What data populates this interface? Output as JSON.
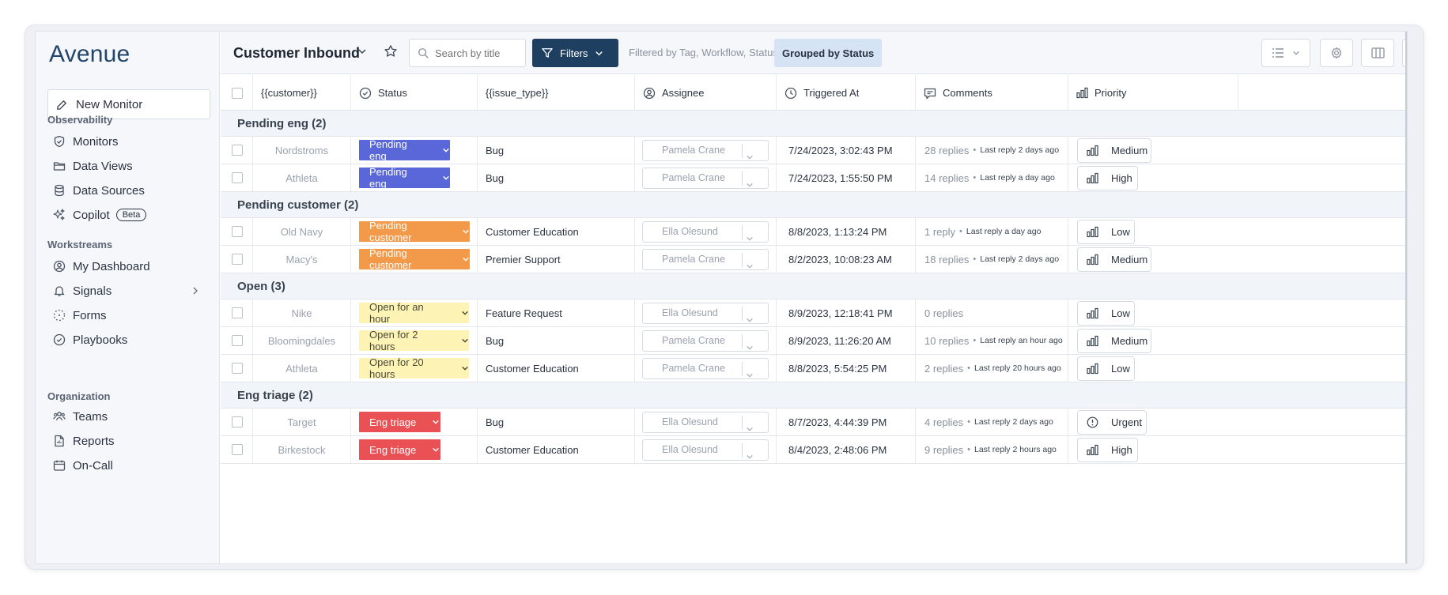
{
  "app": {
    "logo": "Avenue",
    "new_monitor_label": "New Monitor"
  },
  "sidebar": {
    "sections": [
      {
        "label": "Observability",
        "items": [
          {
            "label": "Monitors",
            "icon": "shield-icon"
          },
          {
            "label": "Data Views",
            "icon": "folder-icon"
          },
          {
            "label": "Data Sources",
            "icon": "database-icon"
          },
          {
            "label": "Copilot",
            "icon": "sparkle-icon",
            "badge": "Beta"
          }
        ]
      },
      {
        "label": "Workstreams",
        "items": [
          {
            "label": "My Dashboard",
            "icon": "user-circle-icon"
          },
          {
            "label": "Signals",
            "icon": "bell-icon"
          },
          {
            "label": "Forms",
            "icon": "dotted-circle-icon"
          },
          {
            "label": "Playbooks",
            "icon": "check-circle-icon"
          }
        ]
      },
      {
        "label": "Organization",
        "items": [
          {
            "label": "Teams",
            "icon": "team-icon"
          },
          {
            "label": "Reports",
            "icon": "report-icon"
          },
          {
            "label": "On-Call",
            "icon": "calendar-icon"
          }
        ]
      }
    ]
  },
  "toolbar": {
    "title": "Customer Inbound",
    "search_placeholder": "Search by title",
    "filters_label": "Filters",
    "filtered_text": "Filtered by Tag, Workflow, Status",
    "grouped_label": "Grouped by Status"
  },
  "table": {
    "columns": [
      {
        "label": "{{customer}}"
      },
      {
        "label": "Status",
        "icon": "check-circle-icon"
      },
      {
        "label": "{{issue_type}}"
      },
      {
        "label": "Assignee",
        "icon": "user-circle-icon"
      },
      {
        "label": "Triggered At",
        "icon": "clock-icon"
      },
      {
        "label": "Comments",
        "icon": "comment-icon"
      },
      {
        "label": "Priority",
        "icon": "bar-chart-icon"
      }
    ],
    "groups": [
      {
        "label": "Pending eng (2)",
        "rows": [
          {
            "customer": "Nordstroms",
            "status": "Pending eng",
            "status_color": "blue",
            "issue": "Bug",
            "assignee": "Pamela Crane",
            "triggered": "7/24/2023, 3:02:43 PM",
            "replies": "28 replies",
            "last_reply": "Last reply 2 days ago",
            "priority": "Medium",
            "priority_icon": "bar-chart-icon"
          },
          {
            "customer": "Athleta",
            "status": "Pending eng",
            "status_color": "blue",
            "issue": "Bug",
            "assignee": "Pamela Crane",
            "triggered": "7/24/2023, 1:55:50 PM",
            "replies": "14 replies",
            "last_reply": "Last reply a day ago",
            "priority": "High",
            "priority_icon": "bar-chart-icon"
          }
        ]
      },
      {
        "label": "Pending customer (2)",
        "rows": [
          {
            "customer": "Old Navy",
            "status": "Pending customer",
            "status_color": "orange",
            "issue": "Customer Education",
            "assignee": "Ella Olesund",
            "triggered": "8/8/2023, 1:13:24 PM",
            "replies": "1 reply",
            "last_reply": "Last reply a day ago",
            "priority": "Low",
            "priority_icon": "bar-chart-icon"
          },
          {
            "customer": "Macy's",
            "status": "Pending customer",
            "status_color": "orange",
            "issue": "Premier Support",
            "assignee": "Pamela Crane",
            "triggered": "8/2/2023, 10:08:23 AM",
            "replies": "18 replies",
            "last_reply": "Last reply 2 days ago",
            "priority": "Medium",
            "priority_icon": "bar-chart-icon"
          }
        ]
      },
      {
        "label": "Open (3)",
        "rows": [
          {
            "customer": "Nike",
            "status": "Open for an hour",
            "status_color": "yellow",
            "issue": "Feature Request",
            "assignee": "Ella Olesund",
            "triggered": "8/9/2023, 12:18:41 PM",
            "replies": "0 replies",
            "last_reply": "",
            "priority": "Low",
            "priority_icon": "bar-chart-icon"
          },
          {
            "customer": "Bloomingdales",
            "status": "Open for 2 hours",
            "status_color": "yellow",
            "issue": "Bug",
            "assignee": "Pamela Crane",
            "triggered": "8/9/2023, 11:26:20 AM",
            "replies": "10 replies",
            "last_reply": "Last reply an hour ago",
            "priority": "Medium",
            "priority_icon": "bar-chart-icon"
          },
          {
            "customer": "Athleta",
            "status": "Open for 20 hours",
            "status_color": "yellow",
            "issue": "Customer Education",
            "assignee": "Pamela Crane",
            "triggered": "8/8/2023, 5:54:25 PM",
            "replies": "2 replies",
            "last_reply": "Last reply 20 hours ago",
            "priority": "Low",
            "priority_icon": "bar-chart-icon"
          }
        ]
      },
      {
        "label": "Eng triage (2)",
        "rows": [
          {
            "customer": "Target",
            "status": "Eng triage",
            "status_color": "red",
            "issue": "Bug",
            "assignee": "Ella Olesund",
            "triggered": "8/7/2023, 4:44:39 PM",
            "replies": "4 replies",
            "last_reply": "Last reply 2 days ago",
            "priority": "Urgent",
            "priority_icon": "alert-circle-icon"
          },
          {
            "customer": "Birkestock",
            "status": "Eng triage",
            "status_color": "red",
            "issue": "Customer Education",
            "assignee": "Ella Olesund",
            "triggered": "8/4/2023, 2:48:06 PM",
            "replies": "9 replies",
            "last_reply": "Last reply 2 hours ago",
            "priority": "High",
            "priority_icon": "bar-chart-icon"
          }
        ]
      }
    ]
  },
  "colors": {
    "blue": "#5a67d8",
    "orange": "#f39a4a",
    "yellow": "#fdf3b5",
    "red": "#ea5154",
    "filters_bg": "#1f3f60",
    "logo": "#21466a"
  }
}
